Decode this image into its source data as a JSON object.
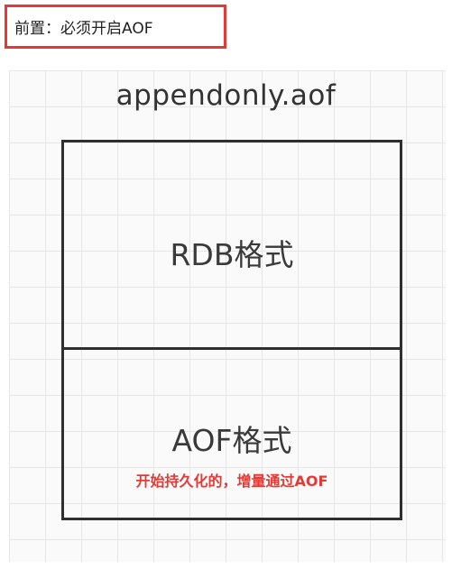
{
  "prerequisite": {
    "text": "前置：必须开启AOF"
  },
  "diagram": {
    "file_name": "appendonly.aof",
    "sections": [
      {
        "label": "RDB格式"
      },
      {
        "label": "AOF格式",
        "note": "开始持久化的，增量通过AOF"
      }
    ]
  },
  "colors": {
    "highlight": "#e53935",
    "border": "#2f2f2f",
    "text": "#333333"
  }
}
